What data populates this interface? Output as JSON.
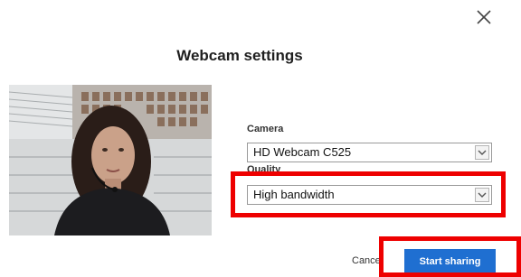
{
  "dialog": {
    "title": "Webcam settings",
    "close_icon": "close-icon"
  },
  "camera": {
    "label": "Camera",
    "selected": "HD Webcam C525"
  },
  "quality": {
    "label": "Quality",
    "selected": "High bandwidth"
  },
  "actions": {
    "cancel_label": "Cancel",
    "start_label": "Start sharing"
  },
  "colors": {
    "primary_button": "#1f6fd1",
    "highlight": "#ee0000"
  }
}
